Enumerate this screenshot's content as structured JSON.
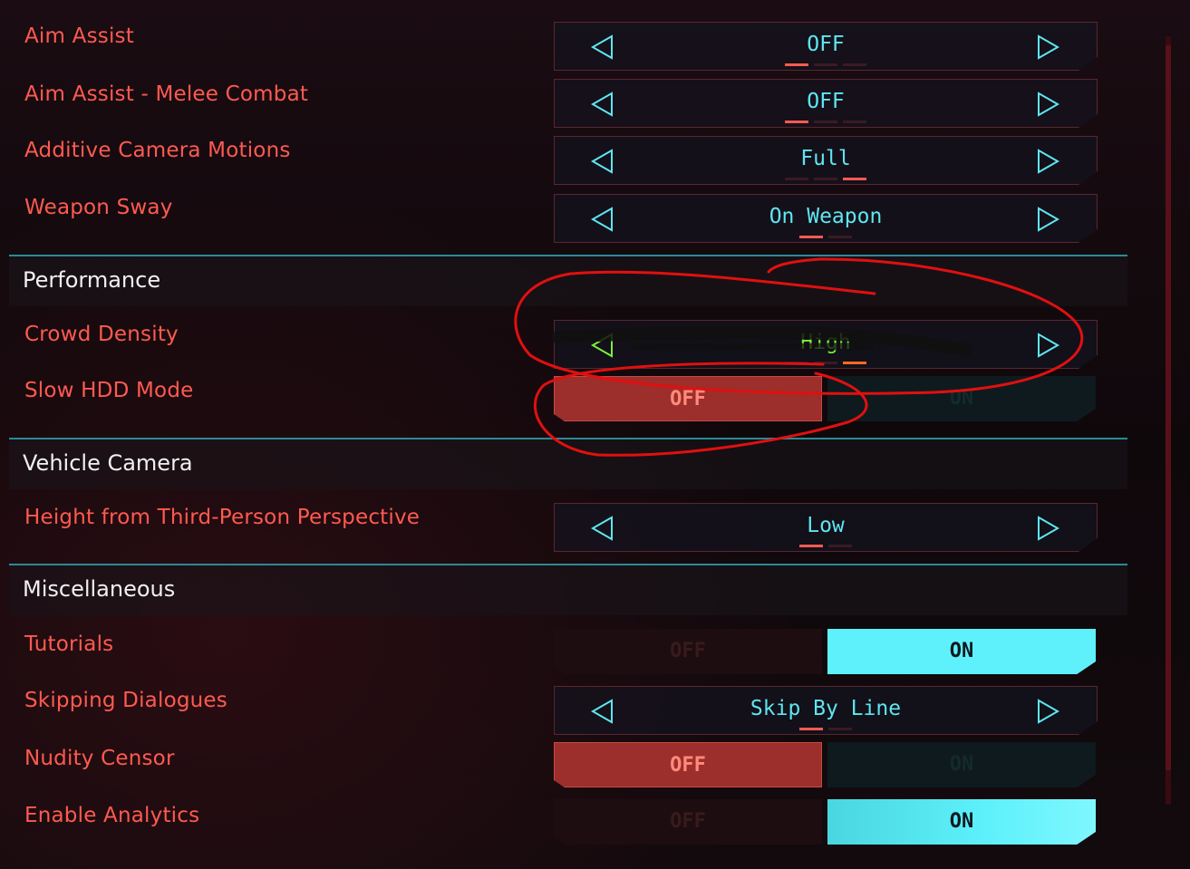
{
  "settings": [
    {
      "label": "Aim Assist",
      "value": "OFF"
    },
    {
      "label": "Aim Assist - Melee Combat",
      "value": "OFF"
    },
    {
      "label": "Additive Camera Motions",
      "value": "Full"
    },
    {
      "label": "Weapon Sway",
      "value": "On Weapon"
    }
  ],
  "performance": {
    "title": "Performance",
    "crowd_density": {
      "label": "Crowd Density",
      "value": "High"
    },
    "slow_hdd": {
      "label": "Slow HDD Mode",
      "off": "OFF",
      "on": "ON"
    }
  },
  "vehicle_camera": {
    "title": "Vehicle Camera",
    "height": {
      "label": "Height from Third-Person Perspective",
      "value": "Low"
    }
  },
  "misc": {
    "title": "Miscellaneous",
    "tutorials": {
      "label": "Tutorials",
      "off": "OFF",
      "on": "ON"
    },
    "skipping": {
      "label": "Skipping Dialogues",
      "value": "Skip By Line"
    },
    "nudity": {
      "label": "Nudity Censor",
      "off": "OFF",
      "on": "ON"
    },
    "analytics": {
      "label": "Enable Analytics",
      "off": "OFF",
      "on": "ON"
    }
  },
  "colors": {
    "label": "#ff5a50",
    "value": "#5ee6f0",
    "highlight_value": "#7cf03a",
    "accent_line": "#2a8a96",
    "on_active": "#5ef1fb",
    "off_active": "#9c2e2c",
    "annotation": "#e01010"
  }
}
